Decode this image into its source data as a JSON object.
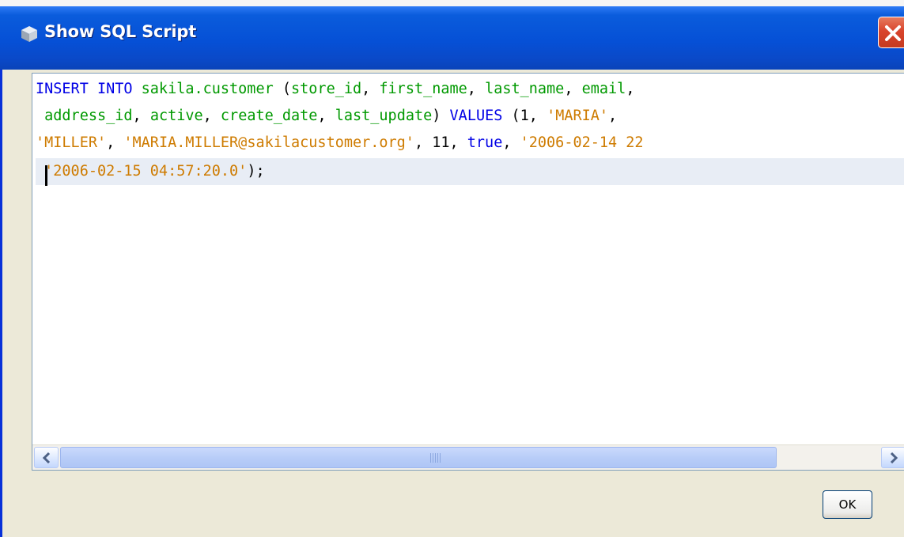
{
  "window": {
    "title": "Show SQL Script",
    "colors": {
      "titlebar": "#0650d6",
      "close": "#d9442c",
      "frame": "#ece9d8"
    }
  },
  "editor": {
    "lines": [
      [
        {
          "t": "INSERT INTO ",
          "c": "kw"
        },
        {
          "t": "sakila.customer",
          "c": "id"
        },
        {
          "t": " (",
          "c": "pl"
        },
        {
          "t": "store_id",
          "c": "id"
        },
        {
          "t": ", ",
          "c": "pl"
        },
        {
          "t": "first_name",
          "c": "id"
        },
        {
          "t": ", ",
          "c": "pl"
        },
        {
          "t": "last_name",
          "c": "id"
        },
        {
          "t": ", ",
          "c": "pl"
        },
        {
          "t": "email",
          "c": "id"
        },
        {
          "t": ",",
          "c": "pl"
        }
      ],
      [
        {
          "t": " ",
          "c": "pl"
        },
        {
          "t": "address_id",
          "c": "id"
        },
        {
          "t": ", ",
          "c": "pl"
        },
        {
          "t": "active",
          "c": "id"
        },
        {
          "t": ", ",
          "c": "pl"
        },
        {
          "t": "create_date",
          "c": "id"
        },
        {
          "t": ", ",
          "c": "pl"
        },
        {
          "t": "last_update",
          "c": "id"
        },
        {
          "t": ") ",
          "c": "pl"
        },
        {
          "t": "VALUES",
          "c": "kw"
        },
        {
          "t": " (1, ",
          "c": "pl"
        },
        {
          "t": "'MARIA'",
          "c": "str"
        },
        {
          "t": ",",
          "c": "pl"
        }
      ],
      [
        {
          "t": "'MILLER'",
          "c": "str"
        },
        {
          "t": ", ",
          "c": "pl"
        },
        {
          "t": "'MARIA.MILLER@sakilacustomer.org'",
          "c": "str"
        },
        {
          "t": ", 11, ",
          "c": "pl"
        },
        {
          "t": "true",
          "c": "kw"
        },
        {
          "t": ", ",
          "c": "pl"
        },
        {
          "t": "'2006-02-14 22",
          "c": "str"
        }
      ],
      [
        {
          "t": " ",
          "c": "pl"
        },
        {
          "t": "'2006-02-15 04:57:20.0'",
          "c": "str"
        },
        {
          "t": ");",
          "c": "pl"
        }
      ]
    ],
    "current_line": 3
  },
  "scrollbar": {
    "grip": "III"
  },
  "buttons": {
    "ok_label": "OK"
  }
}
